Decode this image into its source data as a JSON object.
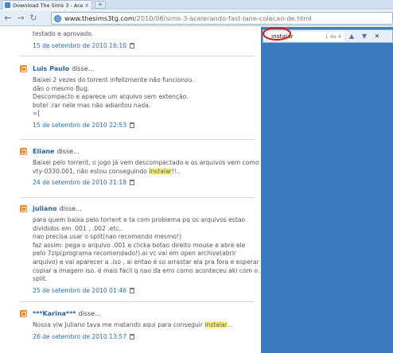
{
  "browser": {
    "tab_title": "Download The Sims 3 - Acel",
    "tab_close": "×",
    "new_tab": "+",
    "back": "←",
    "forward": "→",
    "reload": "↻",
    "url_host": "www.thesims3tg.com",
    "url_path": "/2010/06/sims-3-acelerando-fast-lane-colecao-de.html"
  },
  "find_bar": {
    "query": "instalar",
    "count": "1 de 4",
    "prev": "▲",
    "next": "▼",
    "close": "✕"
  },
  "comments": [
    {
      "author": "",
      "says": "",
      "lines": [
        "testado e aprovado."
      ],
      "timestamp": "15 de setembro de 2010 16:10"
    },
    {
      "author": "Luis Paulo",
      "says": "disse...",
      "lines": [
        "Baixei 2 vezes do torrent infelizmente não funcionou.",
        "dão o mesmo Bug.",
        "Descompacto e aparece um arquivo sem extenção.",
        "botei .rar nele mas não adiantou nada.",
        "=["
      ],
      "timestamp": "15 de setembro de 2010 22:53"
    },
    {
      "author": "Eliane",
      "says": "disse...",
      "lines": [
        "Baixei pelo torrent, o jogo já vem descompactado e os arquivos vem como",
        "vty-0330.001, não estou conseguindo ",
        "!!.."
      ],
      "highlight": "instalar",
      "timestamp": "24 de setembro de 2010 21:18"
    },
    {
      "author": "juliano",
      "says": "disse...",
      "lines": [
        "para quem baixa pelo torrent e ta com problema pq os arquivos estao",
        "divididos em .001 , .002 .etc..",
        "nao precisa usar o split(nao recomendo mesmo!)",
        "faz assim: pega o arquivo .001 e clicka botao direito mouse e abre ele",
        "pelo 7zip(programa recomendado!).ai vc vai em open archive(abrir",
        "arquivo) e vai aparecer a .iso , ai entao é so arrastar ela pra fora e esperar",
        "copiar a imagem iso. é mais facil q nao da erro como aconteceu aki com o",
        "split."
      ],
      "timestamp": "25 de setembro de 2010 01:46"
    },
    {
      "author": "***Karina***",
      "says": "disse...",
      "lines": [
        "Nossa vlw Juliano tava me matando aqui para conseguir ",
        "..."
      ],
      "highlight": "instalar",
      "timestamp": "26 de setembro de 2010 13:57"
    }
  ],
  "colors": {
    "sidebar": "#3a7bbf",
    "author": "#2a5f9e",
    "highlight": "#fbf48a",
    "blogger_icon": "#f58220",
    "find_ring": "#dd1111"
  }
}
